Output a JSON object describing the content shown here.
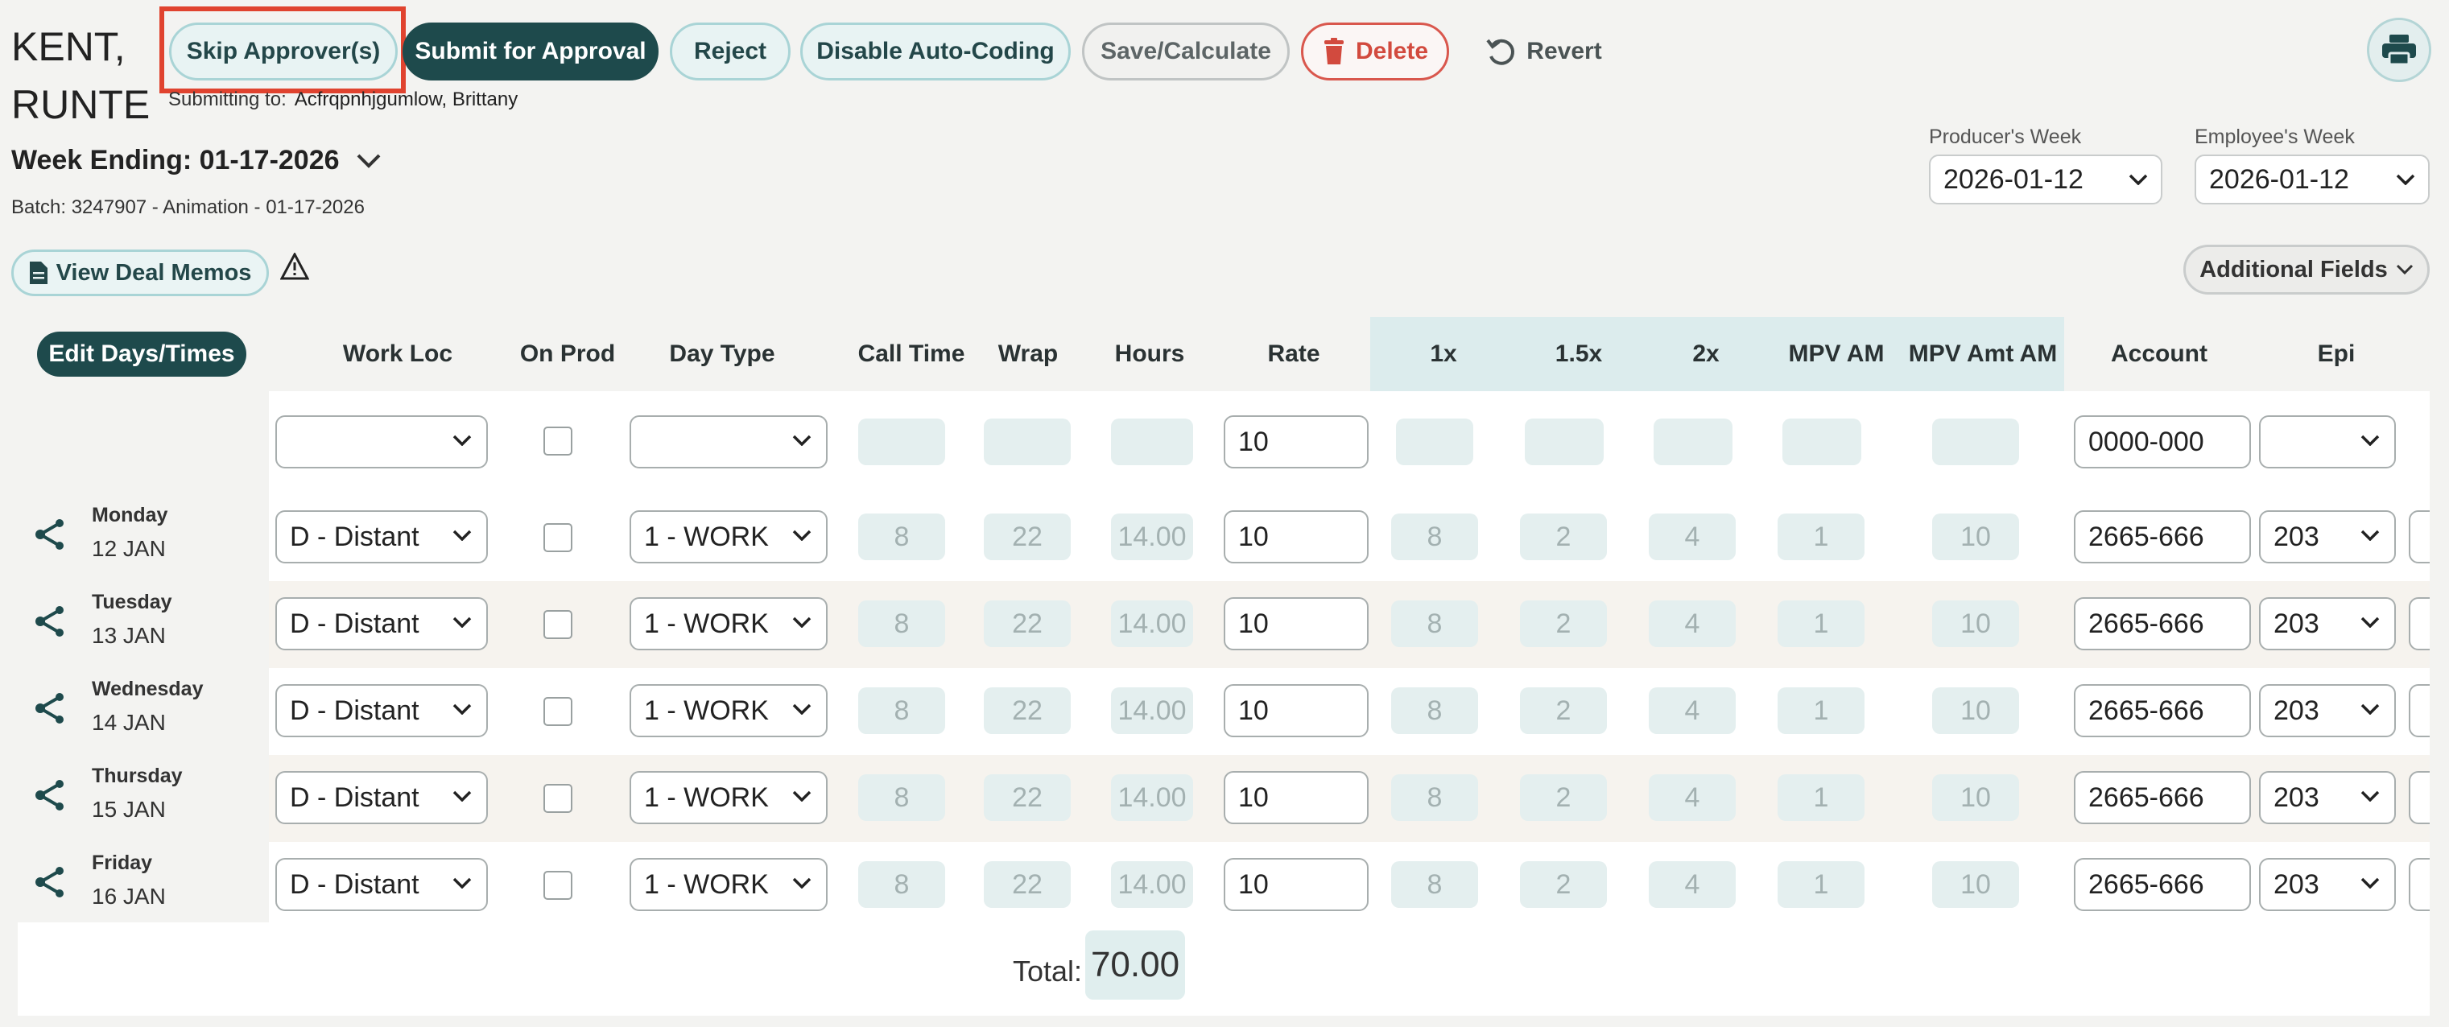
{
  "employee": {
    "name_line1": "KENT,",
    "name_line2": "RUNTE"
  },
  "toolbar": {
    "skip_label": "Skip Approver(s)",
    "submit_label": "Submit for Approval",
    "reject_label": "Reject",
    "disable_label": "Disable Auto-Coding",
    "save_label": "Save/Calculate",
    "delete_label": "Delete",
    "revert_label": "Revert"
  },
  "submitting": {
    "label": "Submitting to:",
    "approver": "Acfrqpnhjgumlow, Brittany"
  },
  "week": {
    "label": "Week Ending: 01-17-2026",
    "batch": "Batch: 3247907 - Animation - 01-17-2026"
  },
  "producer_week": {
    "label": "Producer's Week",
    "value": "2026-01-12"
  },
  "employee_week": {
    "label": "Employee's Week",
    "value": "2026-01-12"
  },
  "memos_label": "View Deal Memos",
  "additional_fields_label": "Additional Fields",
  "table": {
    "edit_label": "Edit Days/Times",
    "columns": [
      "Work Loc",
      "On Prod",
      "Day Type",
      "Call Time",
      "Wrap",
      "Hours",
      "Rate",
      "1x",
      "1.5x",
      "2x",
      "MPV AM",
      "MPV Amt AM",
      "Account",
      "Epi"
    ],
    "template_row": {
      "rate": "10",
      "account": "0000-000"
    },
    "rows": [
      {
        "day": "Monday",
        "date": "12 JAN",
        "work_loc": "D - Distant",
        "day_type": "1 - WORK",
        "call": "8",
        "wrap": "22",
        "hours": "14.00",
        "rate": "10",
        "x1": "8",
        "x15": "2",
        "x2": "4",
        "mpv": "1",
        "mpv_amt": "10",
        "account": "2665-666",
        "epi": "203"
      },
      {
        "day": "Tuesday",
        "date": "13 JAN",
        "work_loc": "D - Distant",
        "day_type": "1 - WORK",
        "call": "8",
        "wrap": "22",
        "hours": "14.00",
        "rate": "10",
        "x1": "8",
        "x15": "2",
        "x2": "4",
        "mpv": "1",
        "mpv_amt": "10",
        "account": "2665-666",
        "epi": "203"
      },
      {
        "day": "Wednesday",
        "date": "14 JAN",
        "work_loc": "D - Distant",
        "day_type": "1 - WORK",
        "call": "8",
        "wrap": "22",
        "hours": "14.00",
        "rate": "10",
        "x1": "8",
        "x15": "2",
        "x2": "4",
        "mpv": "1",
        "mpv_amt": "10",
        "account": "2665-666",
        "epi": "203"
      },
      {
        "day": "Thursday",
        "date": "15 JAN",
        "work_loc": "D - Distant",
        "day_type": "1 - WORK",
        "call": "8",
        "wrap": "22",
        "hours": "14.00",
        "rate": "10",
        "x1": "8",
        "x15": "2",
        "x2": "4",
        "mpv": "1",
        "mpv_amt": "10",
        "account": "2665-666",
        "epi": "203"
      },
      {
        "day": "Friday",
        "date": "16 JAN",
        "work_loc": "D - Distant",
        "day_type": "1 - WORK",
        "call": "8",
        "wrap": "22",
        "hours": "14.00",
        "rate": "10",
        "x1": "8",
        "x15": "2",
        "x2": "4",
        "mpv": "1",
        "mpv_amt": "10",
        "account": "2665-666",
        "epi": "203"
      }
    ],
    "total_label": "Total:",
    "total_value": "70.00"
  },
  "colors": {
    "accent_dark": "#1e4a4c",
    "accent_light": "#a9d4d6",
    "danger": "#d24a3e",
    "highlight": "#e0432f"
  }
}
